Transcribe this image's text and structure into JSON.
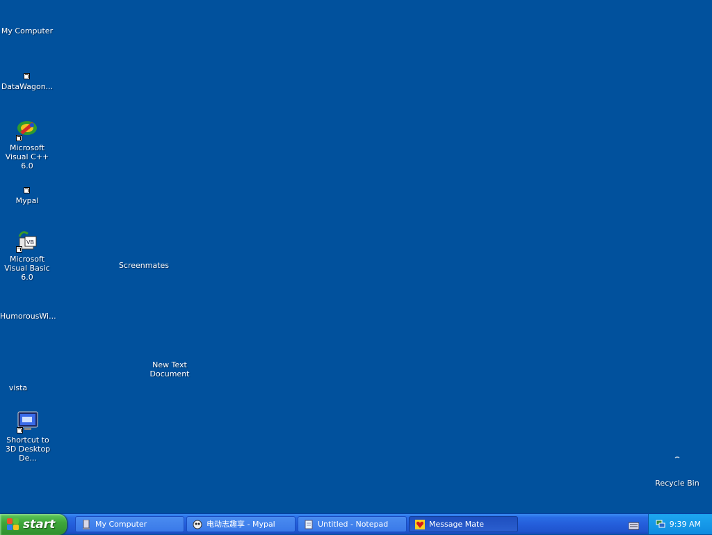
{
  "desktop": {
    "icons": [
      {
        "label": "My Computer"
      },
      {
        "label": "DataWagon..."
      },
      {
        "label": "Microsoft Visual C++ 6.0"
      },
      {
        "label": "Mypal"
      },
      {
        "label": "Microsoft Visual Basic 6.0"
      },
      {
        "label": "Screenmates"
      },
      {
        "label": "HumorousWi..."
      },
      {
        "label": "New Text Document"
      },
      {
        "label": "vista"
      },
      {
        "label": "Shortcut to 3D Desktop De..."
      },
      {
        "label": "Recycle Bin"
      }
    ]
  },
  "taskbar": {
    "start_label": "start",
    "buttons": [
      {
        "label": "My Computer",
        "icon": "computer-icon"
      },
      {
        "label": "电动志趣享 - Mypal",
        "icon": "mypal-icon"
      },
      {
        "label": "Untitled - Notepad",
        "icon": "notepad-icon"
      },
      {
        "label": "Message Mate",
        "icon": "heart-icon",
        "active": true
      }
    ],
    "clock": "9:39 AM"
  },
  "colors": {
    "desktop_bg": "#01519d",
    "taskbar": "#245edb",
    "start": "#3ea63a",
    "tray": "#0f8be0"
  }
}
